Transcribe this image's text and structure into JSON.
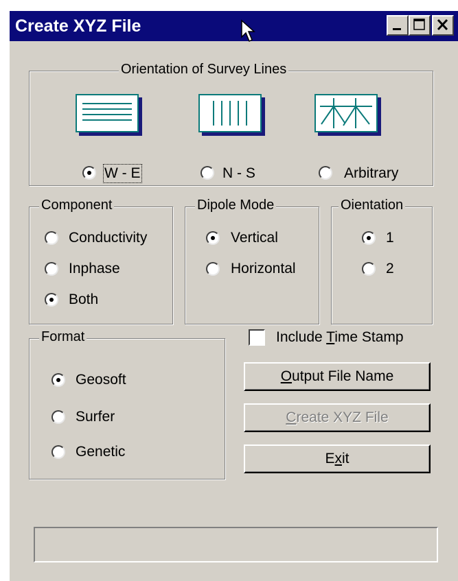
{
  "window": {
    "title": "Create XYZ File",
    "accent_color": "#0a0a7a"
  },
  "orientation": {
    "legend": "Orientation of Survey Lines",
    "options": [
      {
        "label": "W - E",
        "selected": true,
        "icon": "horizontal-lines-icon"
      },
      {
        "label": "N - S",
        "selected": false,
        "icon": "vertical-lines-icon"
      },
      {
        "label": "Arbitrary",
        "selected": false,
        "icon": "arbitrary-lines-icon"
      }
    ]
  },
  "component": {
    "legend": "Component",
    "options": [
      {
        "label": "Conductivity",
        "selected": false
      },
      {
        "label": "Inphase",
        "selected": false
      },
      {
        "label": "Both",
        "selected": true
      }
    ]
  },
  "dipole_mode": {
    "legend": "Dipole Mode",
    "options": [
      {
        "label": "Vertical",
        "selected": true
      },
      {
        "label": "Horizontal",
        "selected": false
      }
    ]
  },
  "oientation": {
    "legend": "Oientation",
    "options": [
      {
        "label": "1",
        "selected": true
      },
      {
        "label": "2",
        "selected": false
      }
    ]
  },
  "format": {
    "legend": "Format",
    "options": [
      {
        "label": "Geosoft",
        "selected": true
      },
      {
        "label": "Surfer",
        "selected": false
      },
      {
        "label": "Genetic",
        "selected": false
      }
    ]
  },
  "timestamp": {
    "label_pre": "Include ",
    "label_key": "T",
    "label_post": "ime Stamp",
    "checked": false
  },
  "buttons": {
    "output_key": "O",
    "output_rest": "utput File Name",
    "create_key": "C",
    "create_rest": "reate XYZ File",
    "exit_pre": "E",
    "exit_key": "x",
    "exit_post": "it"
  },
  "status": {
    "text": ""
  }
}
